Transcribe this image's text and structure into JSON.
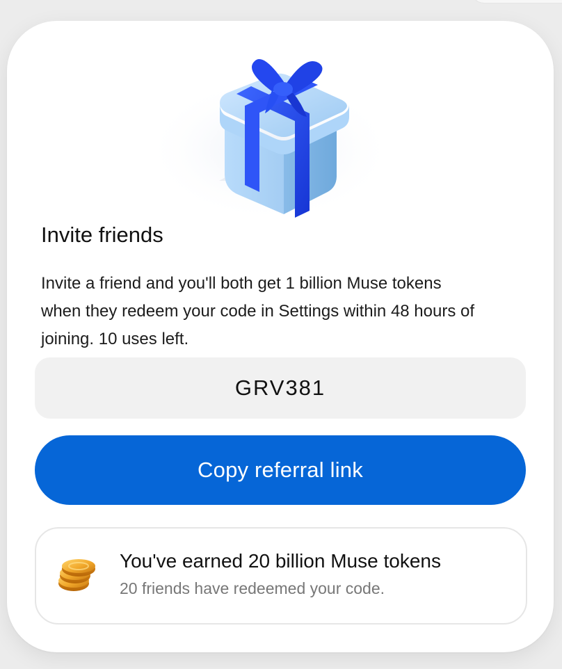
{
  "referral": {
    "title": "Invite friends",
    "description": "Invite a friend and you'll both get 1 billion Muse tokens when they redeem your code in Settings within 48 hours of joining. 10 uses left.",
    "code": "GRV381",
    "copy_button_label": "Copy referral link"
  },
  "earnings": {
    "title": "You've earned 20 billion Muse tokens",
    "subtitle": "20 friends have redeemed your code."
  },
  "icons": {
    "hero": "gift-box-icon",
    "earnings": "coins-icon"
  },
  "colors": {
    "primary": "#0666d7",
    "code_background": "#f1f1f1",
    "secondary_text": "#777777"
  }
}
